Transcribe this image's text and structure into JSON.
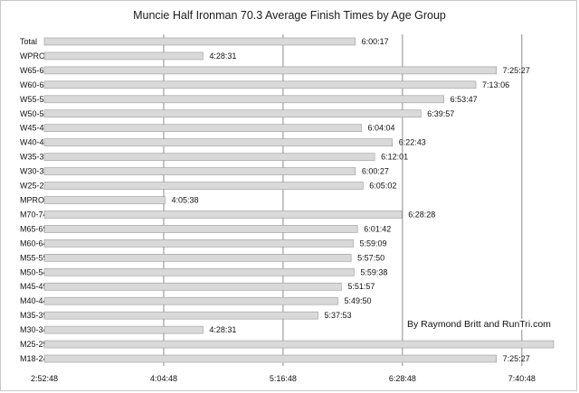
{
  "chart_data": {
    "type": "bar",
    "orientation": "horizontal",
    "title": "Muncie Half Ironman 70.3 Average Finish Times by Age Group",
    "xlabel": "",
    "ylabel": "",
    "x_ticks": [
      "2:52:48",
      "4:04:48",
      "5:16:48",
      "6:28:48",
      "7:40:48"
    ],
    "xlim": [
      "2:52:48",
      "8:00:00"
    ],
    "grid": true,
    "categories": [
      "Total",
      "WPRO",
      "W65-69",
      "W60-64",
      "W55-59",
      "W50-54",
      "W45-49",
      "W40-44",
      "W35-39",
      "W30-34",
      "W25-29",
      "MPRO",
      "M70-74",
      "M65-69",
      "M60-64",
      "M55-59",
      "M50-54",
      "M45-49",
      "M40-44",
      "M35-39",
      "M30-34",
      "M25-29",
      "M18-24"
    ],
    "values": [
      "6:00:17",
      "4:28:31",
      "7:25:27",
      "7:13:06",
      "6:53:47",
      "6:39:57",
      "6:04:04",
      "6:22:43",
      "6:12:01",
      "6:00:27",
      "6:05:02",
      "4:05:38",
      "6:28:28",
      "6:01:42",
      "5:59:09",
      "5:57:50",
      "5:59:38",
      "5:51:57",
      "5:49:50",
      "5:37:53",
      "4:28:31",
      "",
      "7:25:27"
    ],
    "bar_color": "#d9d9d9"
  },
  "annotation": "By Raymond Britt and RunTri.com"
}
